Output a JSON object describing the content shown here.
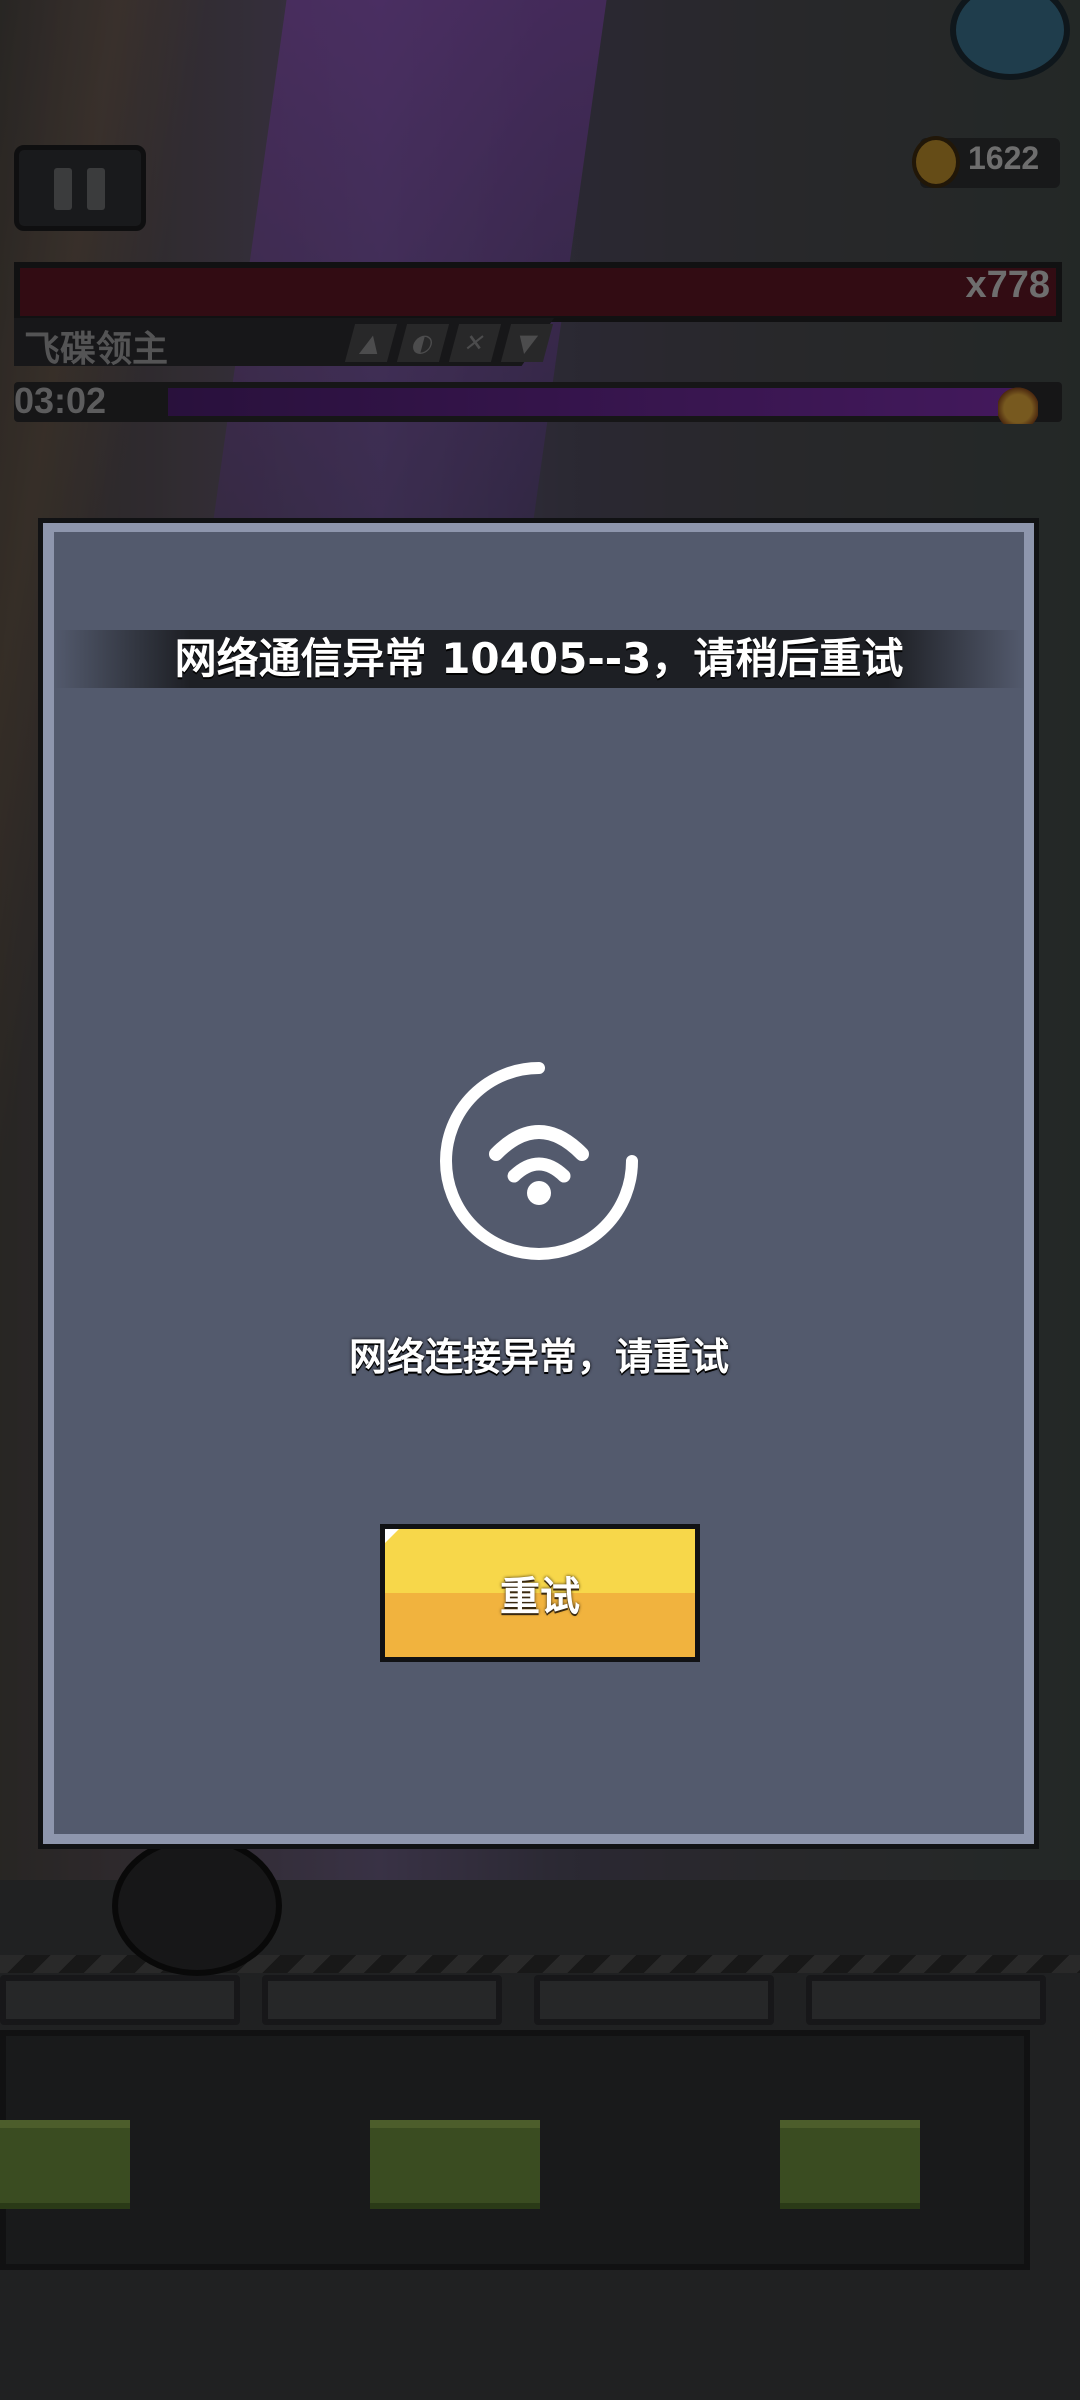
{
  "hud": {
    "score": "1622",
    "boss_multiplier": "x778",
    "boss_name": "飞碟领主",
    "timer": "03:02"
  },
  "dialog": {
    "title": "网络通信异常 10405--3，请稍后重试",
    "status": "网络连接异常，请重试",
    "retry_label": "重试"
  },
  "icons": {
    "pause": "pause-icon",
    "medal": "medal-icon",
    "fire": "fire-icon",
    "wifi": "wifi-loading-icon"
  },
  "colors": {
    "dialog_frame": "#8e96ad",
    "dialog_panel": "#535a6d",
    "button_top": "#f7d74a",
    "button_bottom": "#f1b33e",
    "boss_bar": "#5b1624",
    "timer_bar": "#7a2ea8"
  }
}
